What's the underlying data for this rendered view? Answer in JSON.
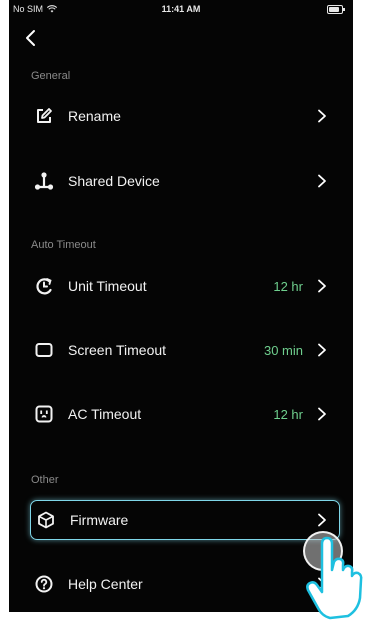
{
  "status_bar": {
    "carrier": "No SIM",
    "time": "11:41 AM"
  },
  "sections": {
    "general": "General",
    "auto_timeout": "Auto Timeout",
    "other": "Other"
  },
  "rows": {
    "rename": {
      "label": "Rename",
      "icon": "edit-icon"
    },
    "shared_device": {
      "label": "Shared Device",
      "icon": "share-icon"
    },
    "unit_timeout": {
      "label": "Unit Timeout",
      "value": "12 hr",
      "icon": "timer-icon"
    },
    "screen_timeout": {
      "label": "Screen Timeout",
      "value": "30 min",
      "icon": "screen-icon"
    },
    "ac_timeout": {
      "label": "AC Timeout",
      "value": "12 hr",
      "icon": "outlet-icon"
    },
    "firmware": {
      "label": "Firmware",
      "icon": "cube-icon"
    },
    "help_center": {
      "label": "Help Center",
      "icon": "help-icon"
    }
  },
  "colors": {
    "background": "#050505",
    "value_green": "#6fcf8e",
    "highlight": "#7fd6e8"
  }
}
